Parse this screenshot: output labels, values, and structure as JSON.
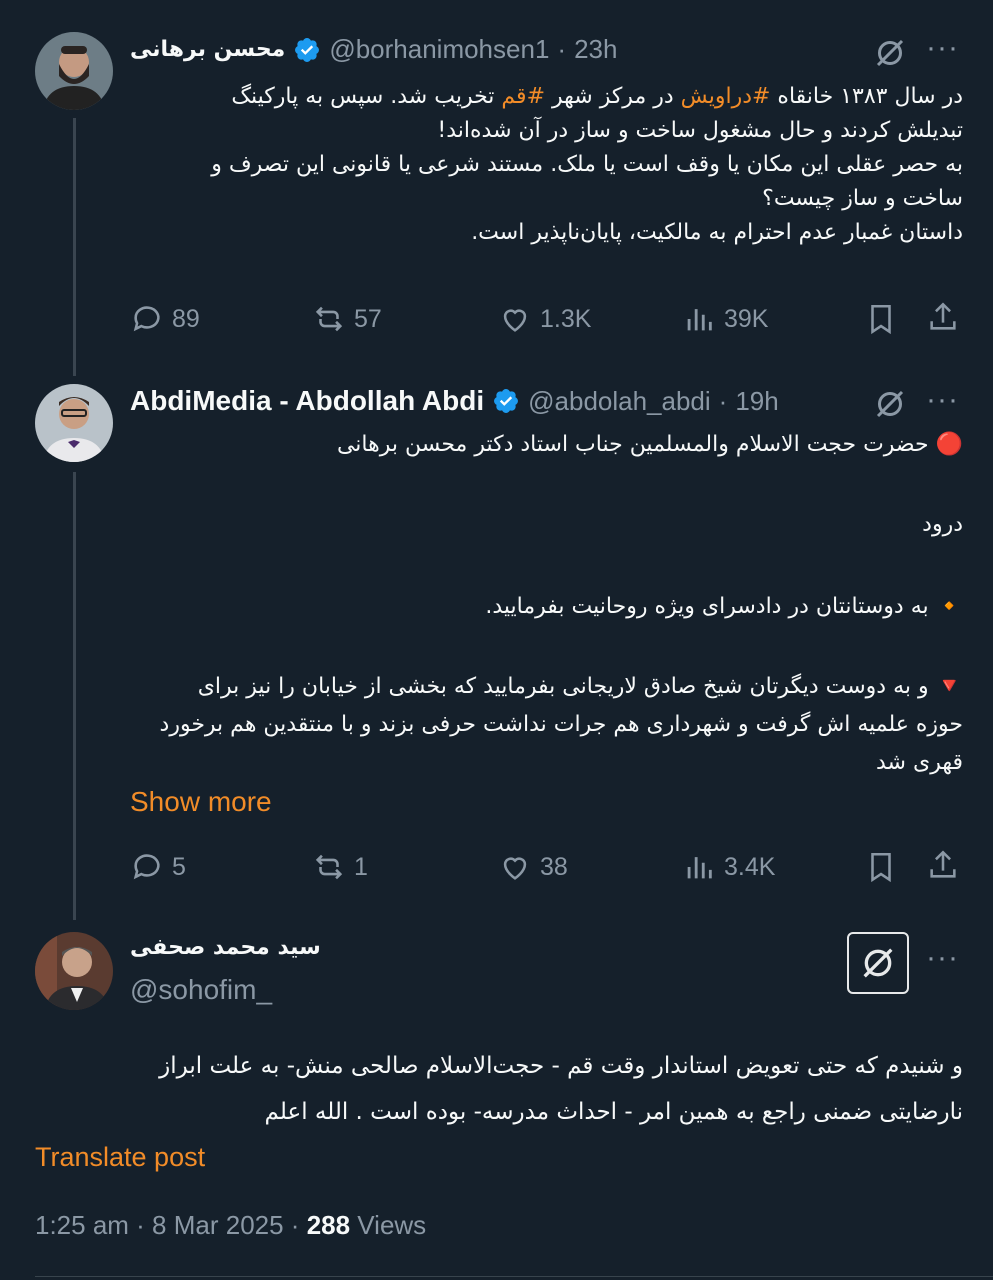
{
  "posts": [
    {
      "name": "محسن برهانی",
      "handle": "@borhanimohsen1",
      "time": "23h",
      "body_lines": [
        [
          "در سال ۱۳۸۳ خانقاه ",
          "#دراویش",
          " در مرکز شهر ",
          "#قم",
          " تخریب شد. سپس به پارکینگ"
        ],
        "تبدیلش کردند و حال مشغول ساخت و ساز در آن شده‌اند!",
        "به حصر عقلی این مکان یا وقف است یا ملک. مستند شرعی یا قانونی این تصرف و",
        "ساخت و ساز چیست؟",
        "داستان غمبار عدم احترام به مالکیت، پایان‌ناپذیر است."
      ],
      "replies": "89",
      "reposts": "57",
      "likes": "1.3K",
      "views": "39K"
    },
    {
      "name": "AbdiMedia - Abdollah Abdi",
      "handle": "@abdolah_abdi",
      "time": "19h",
      "lines": [
        "🔴 حضرت حجت الاسلام والمسلمین جناب استاد دکتر محسن برهانی",
        "درود",
        "🔸 به دوستانتان در دادسرای ویژه روحانیت بفرمایید.",
        "🔻 و به دوست دیگرتان شیخ صادق لاریجانی بفرمایید که بخشی از خیابان را نیز برای",
        "حوزه علمیه اش گرفت و شهرداری هم جرات نداشت حرفی بزند و با منتقدین هم برخورد",
        "قهری شد"
      ],
      "show_more": "Show more",
      "replies": "5",
      "reposts": "1",
      "likes": "38",
      "views": "3.4K"
    },
    {
      "name": "سید محمد صحفی",
      "handle": "@sohofim_",
      "lines": [
        "و  شنیدم که حتی تعویض استاندار وقت قم - حجت‌الاسلام صالحی منش- به علت ابراز",
        "نارضایتی ضمنی راجع به همین امر - احداث مدرسه- بوده است . الله اعلم"
      ],
      "translate": "Translate post",
      "timestamp": "1:25 am · 8 Mar 2025 · ",
      "views_count": "288",
      "views_label": " Views"
    }
  ],
  "colors": {
    "bg": "#15202b",
    "accent": "#f28c28",
    "verified": "#1d9bf0",
    "muted": "#8b98a5"
  },
  "icons": [
    "grok-icon",
    "more-icon",
    "reply-icon",
    "repost-icon",
    "like-icon",
    "views-icon",
    "bookmark-icon",
    "share-icon",
    "verified-icon"
  ]
}
